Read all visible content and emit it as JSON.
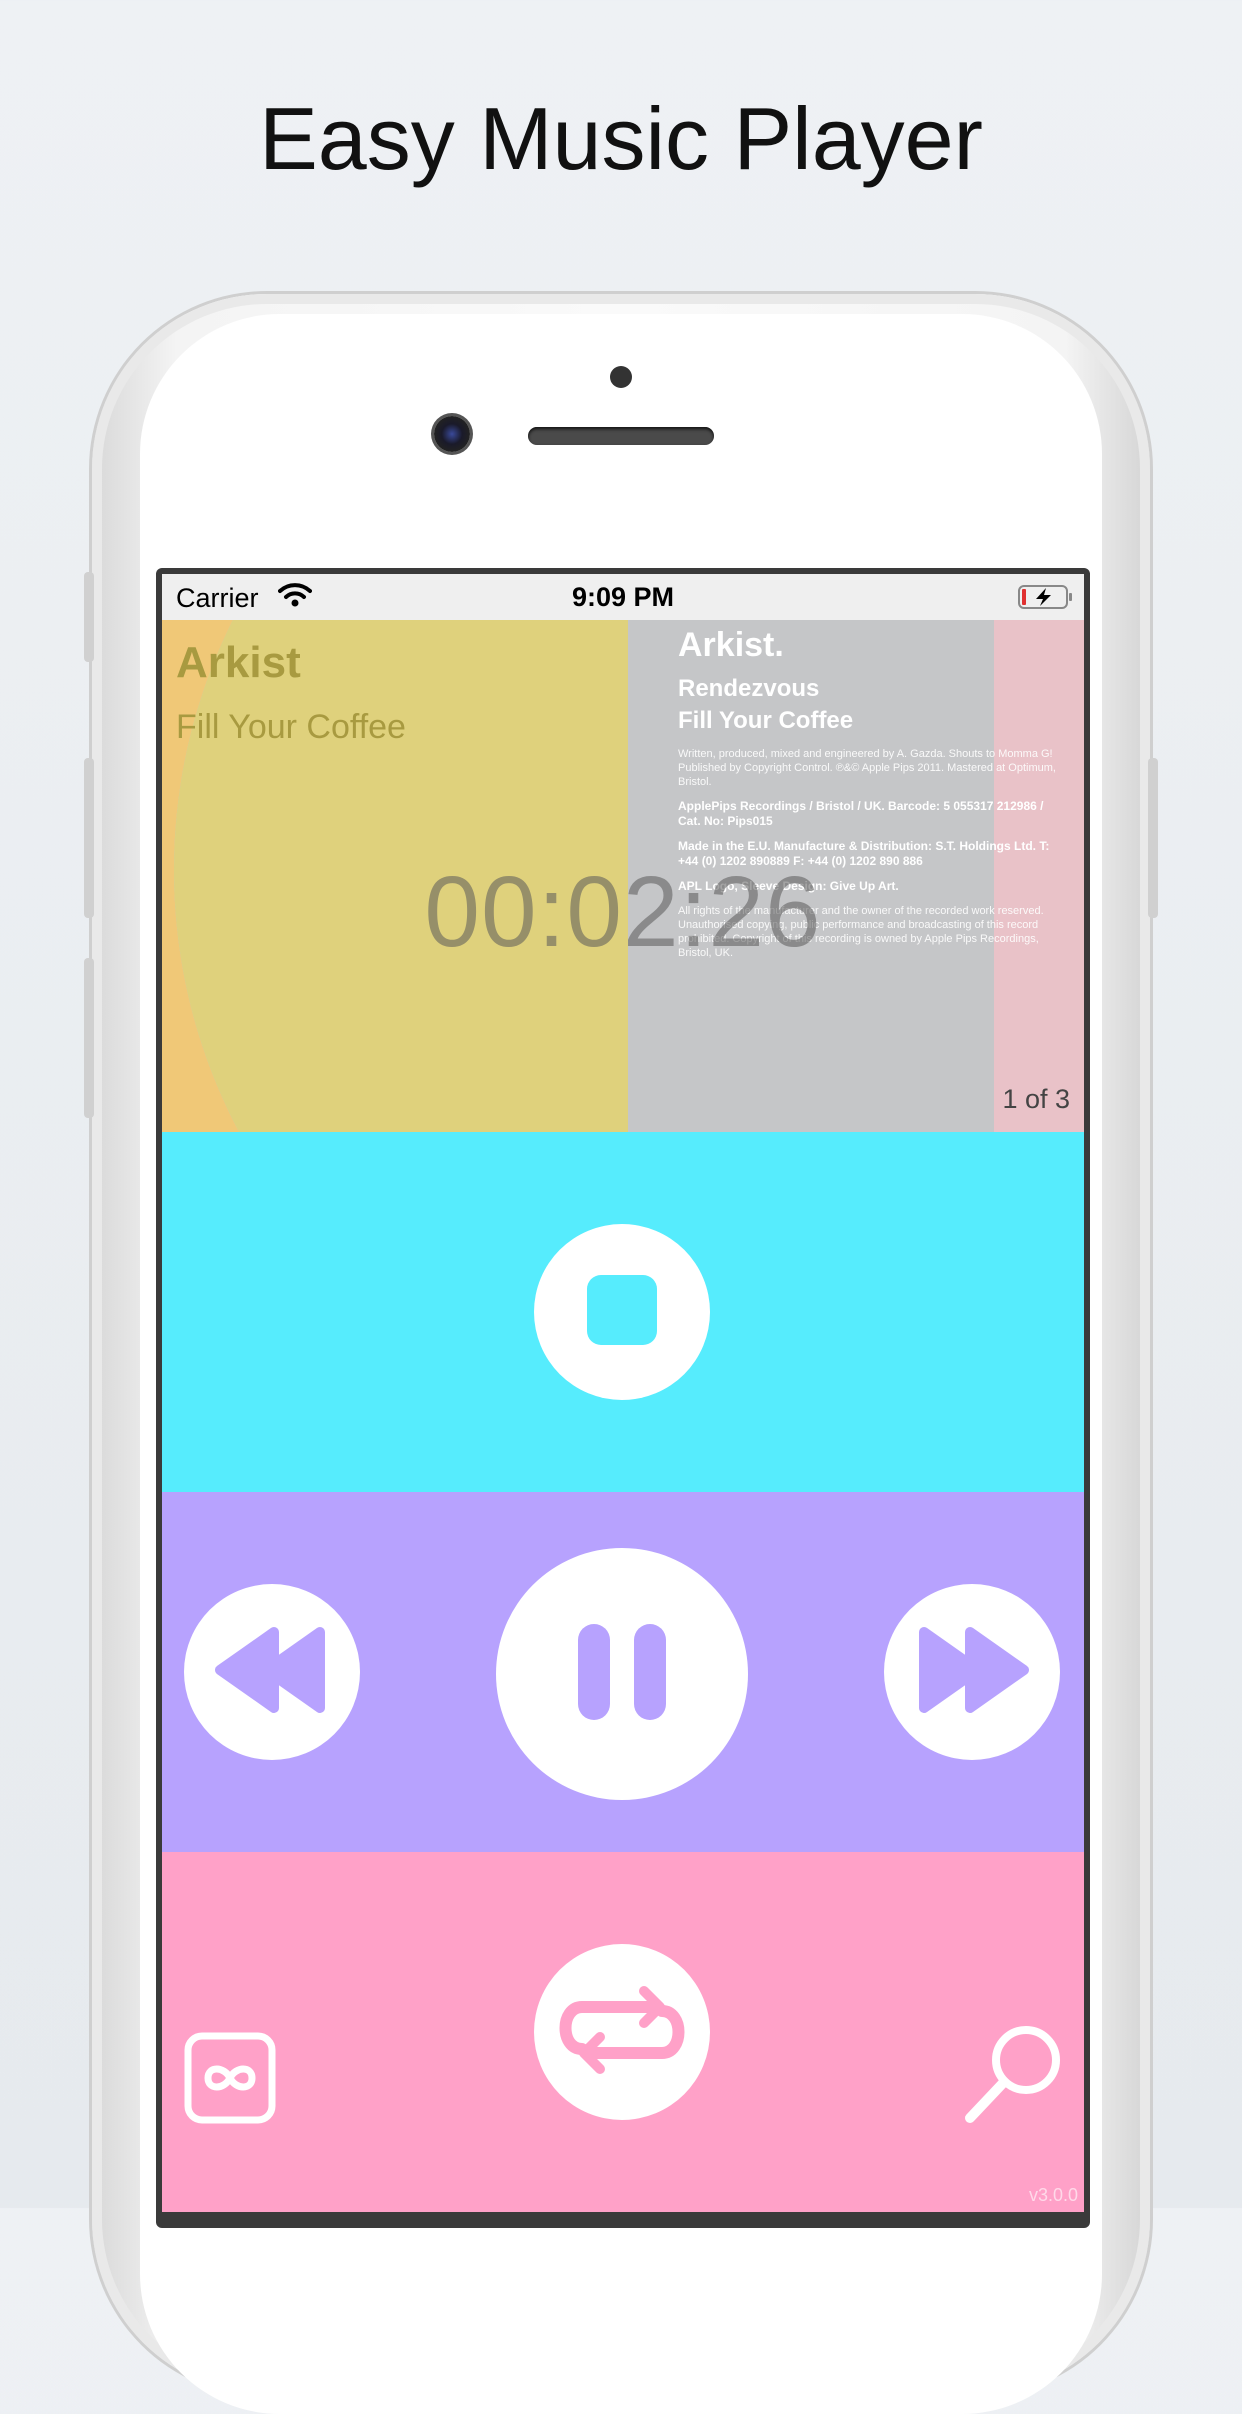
{
  "headline": "Easy Music Player",
  "status_bar": {
    "carrier": "Carrier",
    "time": "9:09 PM"
  },
  "now_playing": {
    "artist": "Arkist",
    "song": "Fill Your Coffee",
    "elapsed": "00:02:26",
    "position": "1 of 3"
  },
  "sleeve": {
    "title": "Arkist.",
    "line1": "Rendezvous",
    "line2": "Fill Your Coffee",
    "credits": "Written, produced, mixed and engineered by A. Gazda. Shouts to Momma G! Published by Copyright Control. ℗&© Apple Pips 2011. Mastered at Optimum, Bristol.",
    "label": "ApplePips Recordings / Bristol / UK. Barcode: 5 055317 212986 / Cat. No: Pips015",
    "made": "Made in the E.U. Manufacture & Distribution: S.T. Holdings Ltd. T: +44 (0) 1202 890889 F: +44 (0) 1202 890 886",
    "art": "APL Logo, Sleeve Design: Give Up Art.",
    "rights": "All rights of the manufacturer and the owner of the recorded work reserved. Unauthorised copying, public performance and broadcasting of this record prohibited. Copyright of this recording is owned by Apple Pips Recordings, Bristol, UK."
  },
  "controls": {
    "stop": "stop-icon",
    "rewind": "rewind-icon",
    "pause": "pause-icon",
    "forward": "fast-forward-icon",
    "repeat": "repeat-icon",
    "infinite": "infinity-icon",
    "search": "search-icon"
  },
  "version": "v3.0.0",
  "colors": {
    "stop_band": "#56ecfd",
    "play_band": "#b7a2fe",
    "options_band": "#ffa1c8",
    "artist_text": "#a89a40"
  }
}
